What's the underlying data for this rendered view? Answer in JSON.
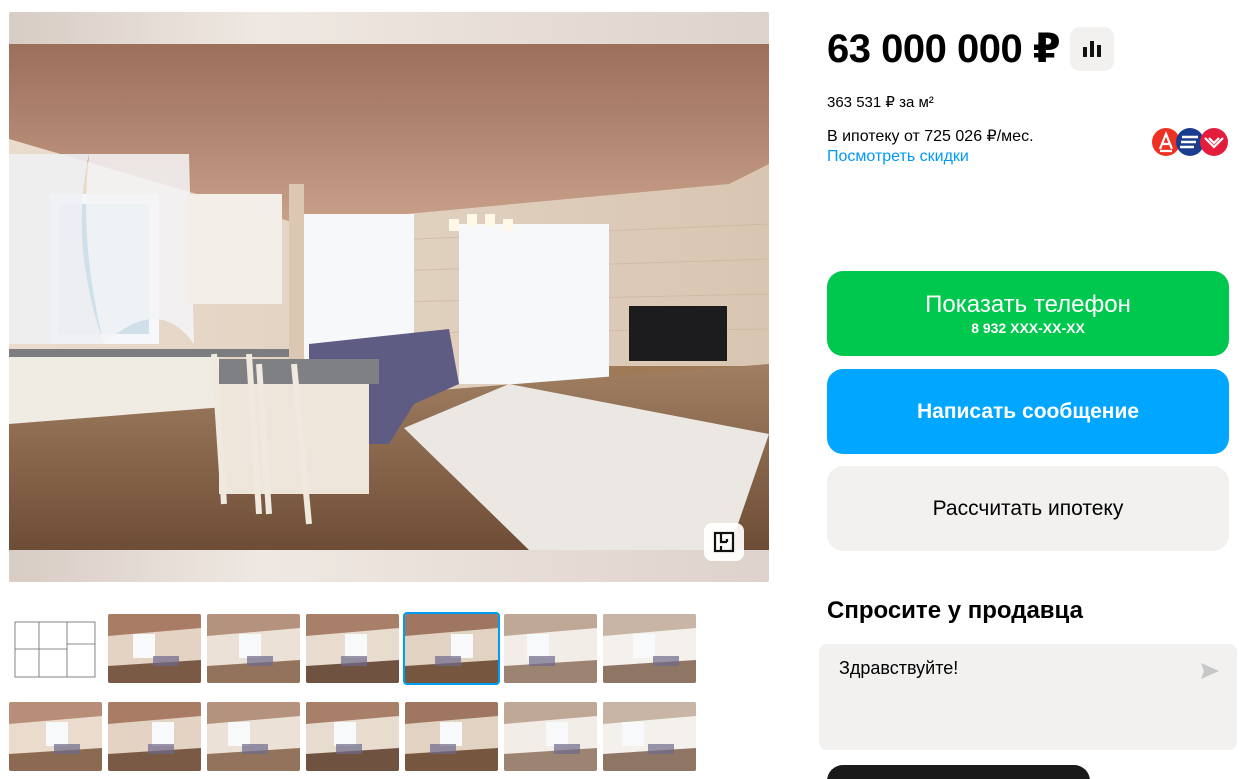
{
  "listing": {
    "price": "63 000 000 ₽",
    "price_per_m2": "363 531 ₽ за м²",
    "mortgage_text": "В ипотеку от 725 026 ₽/мес.",
    "discounts_link": "Посмотреть скидки"
  },
  "actions": {
    "show_phone_label": "Показать телефон",
    "phone_masked": "8 932 XXX-XX-XX",
    "write_message_label": "Написать сообщение",
    "calc_mortgage_label": "Рассчитать ипотеку"
  },
  "ask_seller": {
    "title": "Спросите у продавца",
    "message_value": "Здравствуйте!"
  },
  "gallery": {
    "active_thumb_index": 4,
    "thumb_rows": [
      [
        "floor-plan",
        "living-room",
        "living-room-sofa",
        "kitchen-hall",
        "kitchen-living",
        "kitchen-white",
        "kitchen-fridge"
      ],
      [
        "dining-room",
        "dining-room-2",
        "bedroom",
        "bedroom-2",
        "hallway-doors",
        "stairs",
        "kids-room"
      ]
    ]
  },
  "icons": {
    "stats": "bar-chart-icon",
    "floor_plan": "floor-plan-icon",
    "send": "send-arrow-icon",
    "banks": [
      "alfa-bank-logo",
      "bank-logo-blue",
      "bank-logo-red"
    ]
  },
  "colors": {
    "green": "#00c74d",
    "blue": "#00a6ff",
    "link": "#0099f7",
    "gray_bg": "#f2f1f0",
    "active_outline": "#009cf0"
  }
}
